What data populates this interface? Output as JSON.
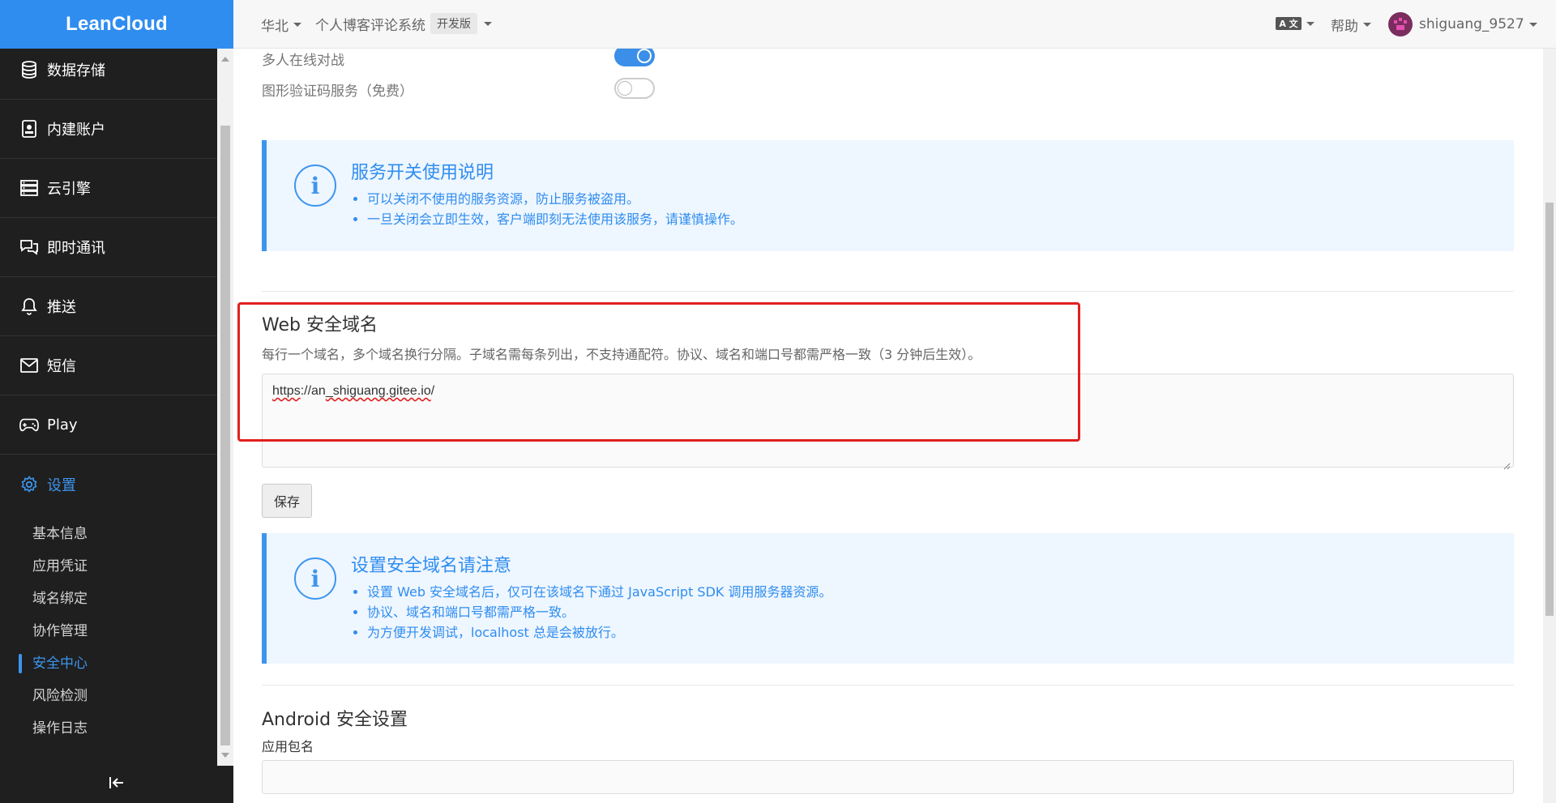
{
  "app": {
    "logo": "LeanCloud"
  },
  "header": {
    "region": "华北",
    "app_name": "个人博客评论系统",
    "plan_badge": "开发版",
    "lang_icon": "translate-icon",
    "help": "帮助",
    "username": "shiguang_9527"
  },
  "sidebar": {
    "items": [
      {
        "label": "数据存储",
        "icon": "database-icon"
      },
      {
        "label": "内建账户",
        "icon": "account-icon"
      },
      {
        "label": "云引擎",
        "icon": "server-icon"
      },
      {
        "label": "即时通讯",
        "icon": "chat-icon"
      },
      {
        "label": "推送",
        "icon": "bell-icon"
      },
      {
        "label": "短信",
        "icon": "mail-icon"
      },
      {
        "label": "Play",
        "icon": "gamepad-icon"
      },
      {
        "label": "设置",
        "icon": "gear-icon"
      }
    ],
    "sub_items": [
      "基本信息",
      "应用凭证",
      "域名绑定",
      "协作管理",
      "安全中心",
      "风险检测",
      "操作日志"
    ],
    "active_sub": "安全中心",
    "collapse_icon": "collapse-sidebar-icon"
  },
  "services": {
    "rows": [
      {
        "label": "多人在线对战",
        "enabled": true
      },
      {
        "label": "图形验证码服务（免费）",
        "enabled": false
      }
    ]
  },
  "service_notice": {
    "title": "服务开关使用说明",
    "items": [
      "可以关闭不使用的服务资源，防止服务被盗用。",
      "一旦关闭会立即生效，客户端即刻无法使用该服务，请谨慎操作。"
    ]
  },
  "web_domain": {
    "title": "Web 安全域名",
    "description": "每行一个域名，多个域名换行分隔。子域名需每条列出，不支持通配符。协议、域名和端口号都需严格一致（3 分钟后生效）。",
    "value_scheme": "https",
    "value_rest": "://an",
    "value_host": "_shiguang.gitee.io",
    "value_tail": "/",
    "save_label": "保存"
  },
  "domain_notice": {
    "title": "设置安全域名请注意",
    "items": [
      "设置 Web 安全域名后，仅可在该域名下通过 JavaScript SDK 调用服务器资源。",
      "协议、域名和端口号都需严格一致。",
      "为方便开发调试，localhost 总是会被放行。"
    ]
  },
  "android": {
    "title": "Android 安全设置",
    "package_label": "应用包名",
    "package_value": ""
  },
  "colors": {
    "brand": "#2f8df0",
    "accent": "#3d95ee",
    "sidebar_bg": "#1f1f1f",
    "highlight": "#e02020"
  }
}
